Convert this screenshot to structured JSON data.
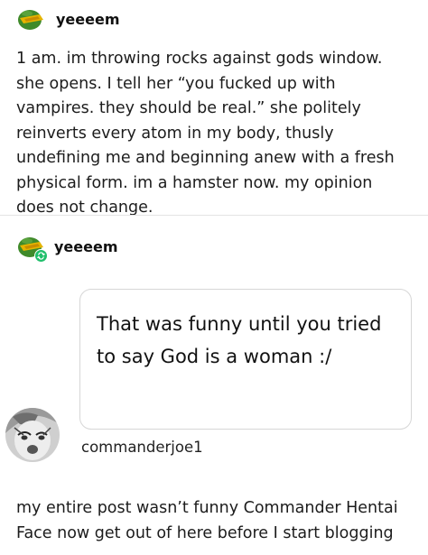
{
  "post1": {
    "username": "yeeeem",
    "text": "1 am. im throwing rocks against gods window. she opens. I tell her “you fucked up with vampires. they should be real.” she politely reinverts every atom in my body, thusly undefining me and beginning anew with a fresh physical form. im a hamster now. my opinion does not change."
  },
  "post2": {
    "username": "yeeeem",
    "ask_text": "That was funny until you tried to say God is a woman :/",
    "asker_name": "commanderjoe1",
    "answer_text": "my entire post wasn’t funny Commander Hentai Face now get out of here before I start blogging"
  },
  "icons": {
    "avatar": "green-helmet-avatar-icon",
    "reblog_badge": "reblog-icon"
  }
}
